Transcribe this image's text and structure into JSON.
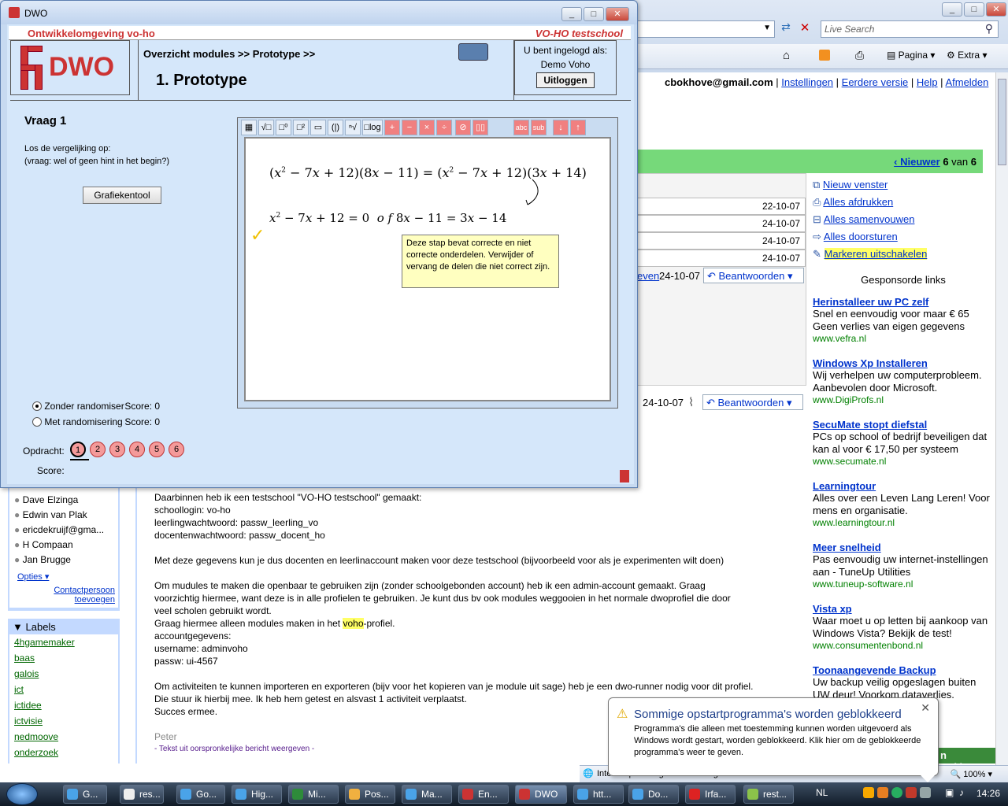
{
  "browser": {
    "search_placeholder": "Live Search",
    "toolbar": {
      "page_label": "Pagina",
      "extra_label": "Extra"
    },
    "status_internet": "Internet | Beveiligde modus: ingeschakeld",
    "zoom": "100%"
  },
  "gmail": {
    "user_email": "cbokhove@gmail.com",
    "top_links": [
      "Instellingen",
      "Eerdere versie",
      "Help",
      "Afmelden"
    ],
    "newer_label": "‹ Nieuwer",
    "count_current": "6",
    "count_sep": "van",
    "count_total": "6",
    "thread_dates": [
      "22-10-07",
      "24-10-07",
      "24-10-07",
      "24-10-07"
    ],
    "reply_rows": [
      {
        "partial": "even",
        "date": "24-10-07",
        "reply": "Beantwoorden"
      },
      {
        "partial": "",
        "date": "24-10-07",
        "reply": "Beantwoorden"
      }
    ],
    "actions": [
      "Nieuw venster",
      "Alles afdrukken",
      "Alles samenvouwen",
      "Alles doorsturen",
      "Markeren uitschakelen"
    ],
    "sponsored_heading": "Gesponsorde links",
    "ads": [
      {
        "title": "Herinstalleer uw PC zelf",
        "text": "Snel en eenvoudig voor maar € 65 Geen verlies van eigen gegevens",
        "url": "www.vefra.nl"
      },
      {
        "title": "Windows Xp Installeren",
        "text": "Wij verhelpen uw computerprobleem. Aanbevolen door Microsoft.",
        "url": "www.DigiProfs.nl"
      },
      {
        "title": "SecuMate stopt diefstal",
        "text": "PCs op school of bedrijf beveiligen dat kan al voor € 17,50 per systeem",
        "url": "www.secumate.nl"
      },
      {
        "title": "Learningtour",
        "text": "Alles over een Leven Lang Leren! Voor mens en organisatie.",
        "url": "www.learningtour.nl"
      },
      {
        "title": "Meer snelheid",
        "text": "Pas eenvoudig uw internet-instellingen aan - TuneUp Utilities",
        "url": "www.tuneup-software.nl"
      },
      {
        "title": "Vista xp",
        "text": "Waar moet u op letten bij aankoop van Windows Vista? Bekijk de test!",
        "url": "www.consumentenbond.nl"
      },
      {
        "title": "Toonaangevende Backup",
        "text": "Uw backup veilig opgeslagen buiten UW deur! Voorkom dataverlies.",
        "url": ""
      }
    ],
    "bottom_name": "n Bokhove",
    "contacts": [
      "Dave Elzinga",
      "Edwin van Plak",
      "ericdekruijf@gma...",
      "H Compaan",
      "Jan Brugge"
    ],
    "options_label": "Opties ▾",
    "contact_add": "Contactpersoon toevoegen",
    "labels_heading": "Labels",
    "labels": [
      "4hgamemaker",
      "baas",
      "galois",
      "ict",
      "ictidee",
      "ictvisie",
      "nedmoove",
      "onderzoek"
    ],
    "message_lines": [
      "Daarbinnen heb ik een testschool \"VO-HO testschool\" gemaakt:",
      "schoollogin: vo-ho",
      "leerlingwachtwoord: passw_leerling_vo",
      "docentenwachtwoord: passw_docent_ho",
      "",
      "Met deze gegevens kun je dus docenten en leerlinaccount maken voor deze testschool (bijvoorbeeld voor als je experimenten wilt doen)",
      "",
      "Om mudules te maken die openbaar te gebruiken zijn (zonder schoolgebonden account) heb ik een admin-account gemaakt. Graag",
      "voorzichtig hiermee, want deze is in alle profielen te gebruiken. Je kunt dus bv ook modules weggooien in het normale dwoprofiel die door",
      "veel scholen gebruikt wordt."
    ],
    "msg_voho_pre": "Graag hiermee alleen modules maken in het ",
    "msg_voho_hl": "voho",
    "msg_voho_post": "-profiel.",
    "message_lines2": [
      "accountgegevens:",
      "username: adminvoho",
      "passw: ui-4567",
      "",
      "Om activiteiten te kunnen importeren en exporteren (bijv voor het kopieren van je module uit sage) heb je een dwo-runner nodig voor dit profiel.",
      "Die stuur ik hierbij mee. Ik heb hem getest en alsvast 1 activiteit verplaatst.",
      "Succes ermee."
    ],
    "signature": "Peter",
    "quoted_link": "- Tekst uit oorspronkelijke bericht weergeven -"
  },
  "dwo": {
    "window_title": "DWO",
    "env_label": "Ontwikkelomgeving vo-ho",
    "school_label": "VO-HO testschool",
    "logo_text": "DWO",
    "breadcrumb": "Overzicht modules >> Prototype >>",
    "page_title": "1.  Prototype",
    "login_label": "U bent ingelogd als:",
    "login_user": "Demo Voho",
    "logout_label": "Uitloggen",
    "question_title": "Vraag 1",
    "question_text1": "Los de vergelijking op:",
    "question_text2": "(vraag: wel of geen hint in het begin?)",
    "graph_button": "Grafiekentool",
    "radio1": "Zonder randomisering",
    "radio2": "Met randomisering",
    "score_line": "Score: 0",
    "opdracht_label": "Opdracht:",
    "opdracht_items": [
      "1",
      "2",
      "3",
      "4",
      "5",
      "6"
    ],
    "score_label": "Score:",
    "toolbar": {
      "log": "log",
      "plus": "+",
      "minus": "−",
      "times": "×",
      "div": "÷",
      "abc": "abc",
      "sub": "sub",
      "down": "↓",
      "up": "↑"
    },
    "tooltip": "Deze stap bevat correcte en niet correcte onderdelen. Verwijder of vervang de delen die niet correct zijn."
  },
  "notification": {
    "title": "Sommige opstartprogramma's worden geblokkeerd",
    "body": "Programma's die alleen met toestemming kunnen worden uitgevoerd als Windows wordt gestart, worden geblokkeerd. Klik hier om de geblokkeerde programma's weer te geven."
  },
  "taskbar": {
    "items": [
      "G...",
      "res...",
      "Go...",
      "Hig...",
      "Mi...",
      "Pos...",
      "Ma...",
      "En...",
      "DWO",
      "htt...",
      "Do...",
      "Irfa...",
      "rest..."
    ],
    "lang": "NL",
    "clock": "14:26"
  }
}
